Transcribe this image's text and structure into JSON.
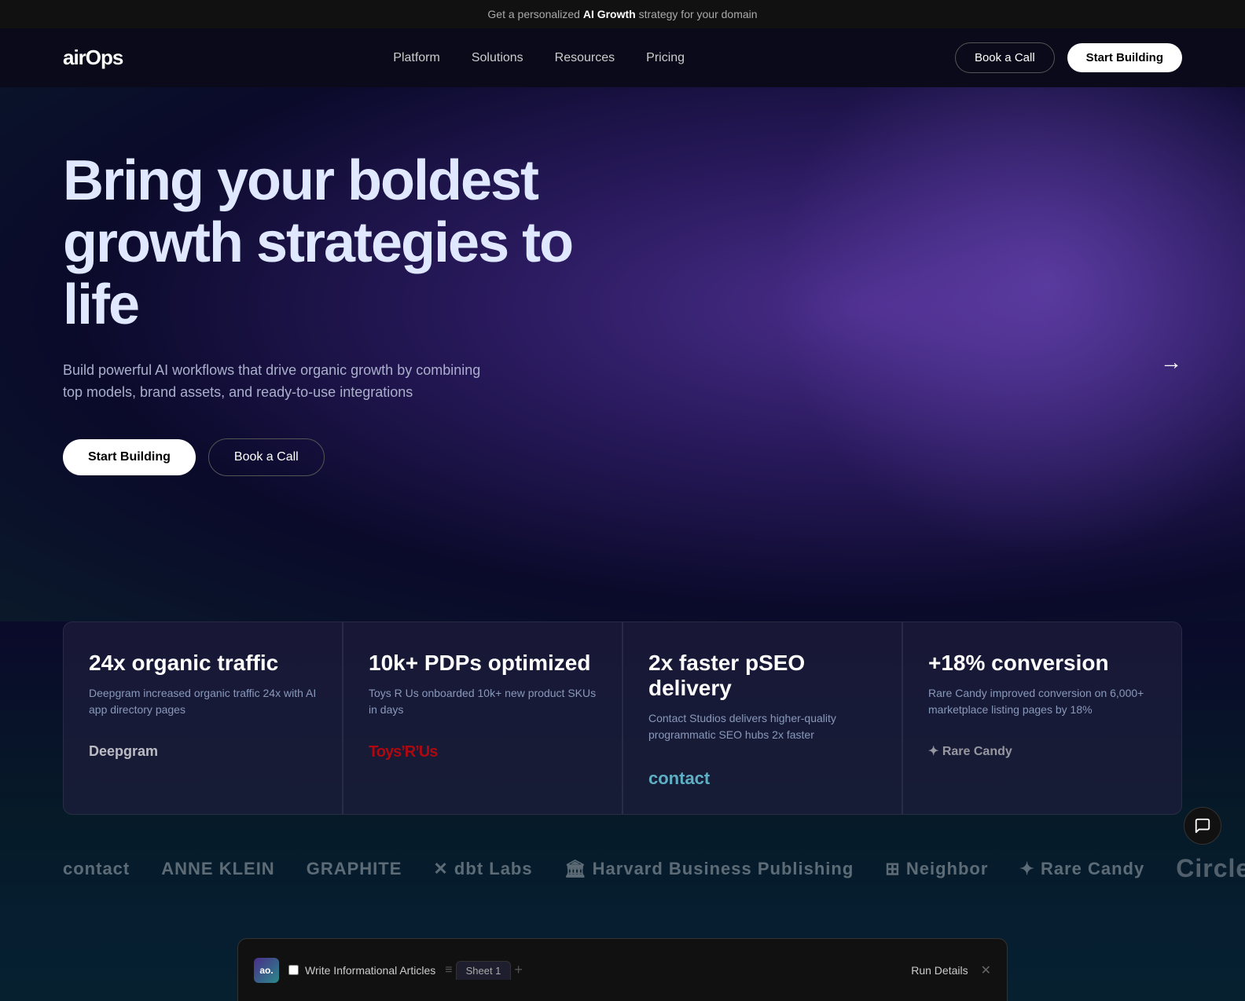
{
  "banner": {
    "text_prefix": "Get a personalized ",
    "text_bold": "AI Growth",
    "text_suffix": " strategy for your domain"
  },
  "nav": {
    "logo": "airOps",
    "links": [
      {
        "label": "Platform"
      },
      {
        "label": "Solutions"
      },
      {
        "label": "Resources"
      },
      {
        "label": "Pricing"
      }
    ],
    "book_call": "Book a Call",
    "start_building": "Start Building"
  },
  "hero": {
    "title_line1": "Bring your boldest",
    "title_line2": "growth strategies to life",
    "subtitle": "Build powerful AI workflows that drive organic growth by combining top models, brand assets, and ready-to-use integrations",
    "btn_primary": "Start Building",
    "btn_secondary": "Book a Call"
  },
  "stats": [
    {
      "number": "24x organic traffic",
      "desc": "Deepgram increased organic traffic 24x with AI app directory pages",
      "logo": "Deepgram",
      "logo_class": "deepgram"
    },
    {
      "number": "10k+ PDPs optimized",
      "desc": "Toys R Us onboarded 10k+ new product SKUs in days",
      "logo": "Toys’R’Us",
      "logo_class": "toysrus"
    },
    {
      "number": "2x faster pSEO delivery",
      "desc": "Contact Studios delivers higher-quality programmatic SEO hubs 2x faster",
      "logo": "contact",
      "logo_class": "contact"
    },
    {
      "number": "+18% conversion",
      "desc": "Rare Candy improved conversion on 6,000+ marketplace listing pages by 18%",
      "logo": "✦ Rare Candy",
      "logo_class": "rarecandy"
    }
  ],
  "logos": [
    {
      "text": "contact",
      "size": "normal"
    },
    {
      "text": "ANNE KLEIN",
      "size": "normal"
    },
    {
      "text": "GRAPHITE",
      "size": "normal"
    },
    {
      "text": "✕ dbt Labs",
      "size": "normal",
      "icon": true
    },
    {
      "text": "🏛 Harvard Business Publishing",
      "size": "normal",
      "icon": true
    },
    {
      "text": "⊞ Neighbor",
      "size": "normal",
      "icon": true
    },
    {
      "text": "✦ Rare Candy",
      "size": "normal",
      "icon": true
    },
    {
      "text": "Circle",
      "size": "large"
    }
  ],
  "app_preview": {
    "icon_text": "ao.",
    "title": "Write Informational Articles",
    "tab_label": "Sheet 1",
    "run_details": "Run Details",
    "checkbox_state": false
  },
  "chat_icon": "💬"
}
